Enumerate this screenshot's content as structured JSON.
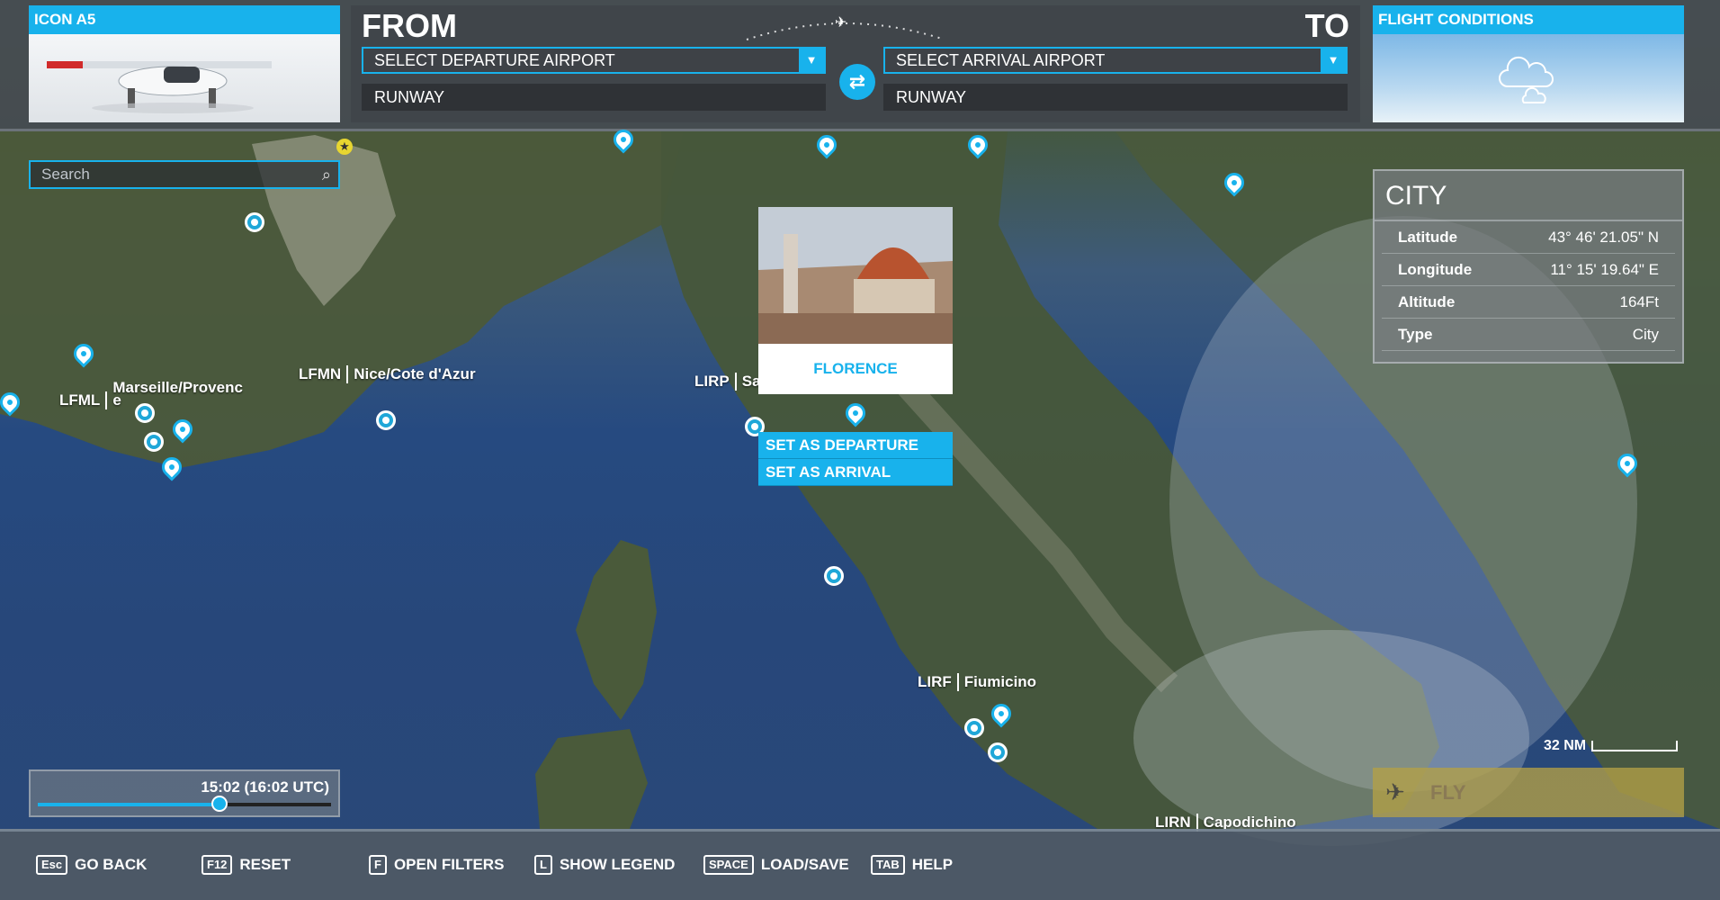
{
  "aircraft_card": {
    "title": "ICON A5"
  },
  "route": {
    "from_label": "FROM",
    "to_label": "TO",
    "departure_select": "SELECT DEPARTURE AIRPORT",
    "arrival_select": "SELECT ARRIVAL AIRPORT",
    "departure_runway": "RUNWAY",
    "arrival_runway": "RUNWAY"
  },
  "conditions_card": {
    "title": "FLIGHT CONDITIONS"
  },
  "search": {
    "placeholder": "Search"
  },
  "info_panel": {
    "title": "CITY",
    "rows": [
      {
        "key": "Latitude",
        "value": "43° 46' 21.05\" N"
      },
      {
        "key": "Longitude",
        "value": "11° 15' 19.64\" E"
      },
      {
        "key": "Altitude",
        "value": "164Ft"
      },
      {
        "key": "Type",
        "value": "City"
      }
    ]
  },
  "popup": {
    "name": "FLORENCE"
  },
  "context_menu": {
    "set_departure": "SET AS DEPARTURE",
    "set_arrival": "SET AS ARRIVAL"
  },
  "airports": [
    {
      "code": "LFML",
      "name": "Marseille/Provenc e"
    },
    {
      "code": "LFMN",
      "name": "Nice/Cote d'Azur"
    },
    {
      "code": "LIRP",
      "name": "Sa"
    },
    {
      "code": "LIRF",
      "name": "Fiumicino"
    },
    {
      "code": "LIRN",
      "name": "Capodichino"
    }
  ],
  "time": {
    "label": "15:02 (16:02 UTC)",
    "day_fraction": 0.62
  },
  "scale": {
    "label": "32 NM"
  },
  "fly_button": {
    "label": "FLY"
  },
  "hotkeys": [
    {
      "key": "Esc",
      "label": "GO BACK"
    },
    {
      "key": "F12",
      "label": "RESET"
    },
    {
      "key": "F",
      "label": "OPEN FILTERS"
    },
    {
      "key": "L",
      "label": "SHOW LEGEND"
    },
    {
      "key": "SPACE",
      "label": "LOAD/SAVE"
    },
    {
      "key": "TAB",
      "label": "HELP"
    }
  ],
  "colors": {
    "accent": "#18b2ec",
    "fly": "#b4a046"
  }
}
